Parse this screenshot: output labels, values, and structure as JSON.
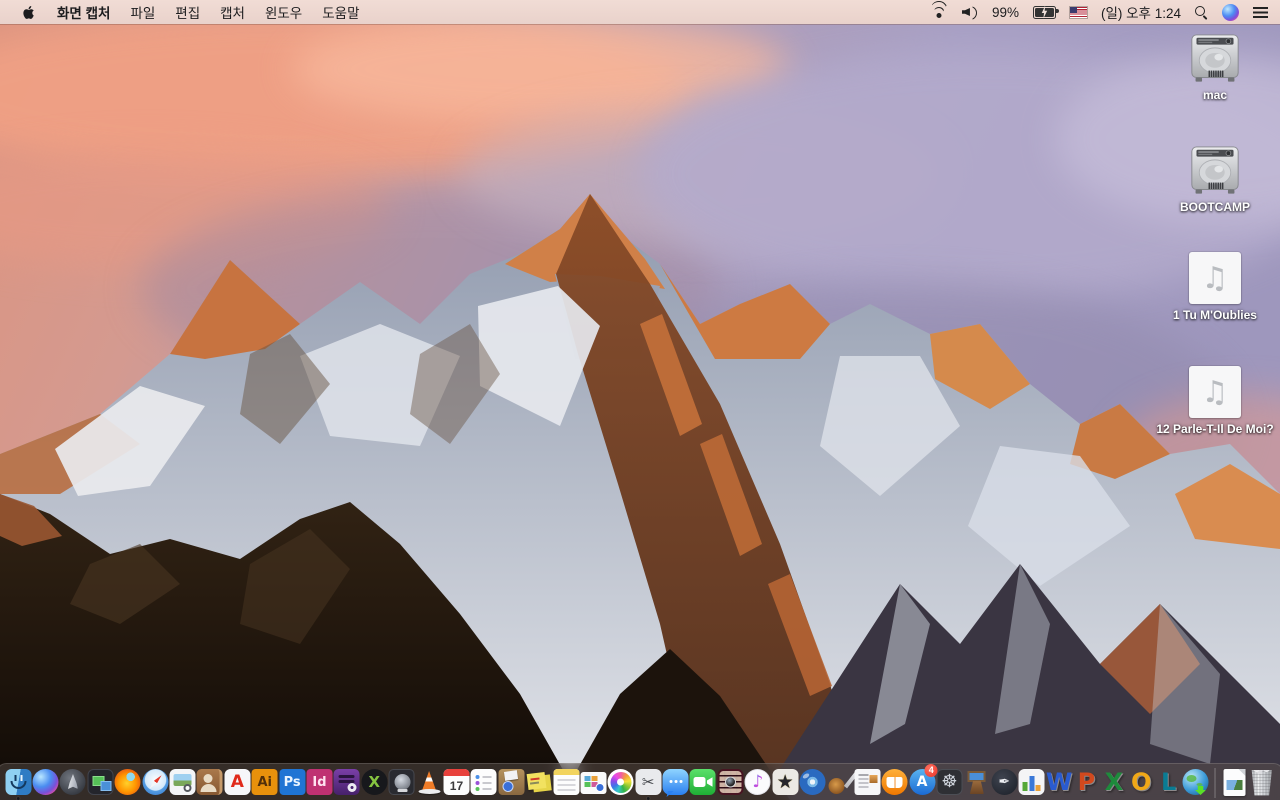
{
  "menu_bar": {
    "app_name": "화면 캡처",
    "menus": [
      "파일",
      "편집",
      "캡처",
      "윈도우",
      "도움말"
    ],
    "status": {
      "battery_percent": "99%",
      "clock": "(일) 오후 1:24"
    },
    "status_icons": [
      "wifi-icon",
      "volume-icon",
      "battery-charging-icon",
      "us-flag-icon",
      "spotlight-search-icon",
      "siri-icon",
      "notification-center-icon"
    ]
  },
  "desktop": {
    "icons": [
      {
        "id": "mac",
        "type": "drive",
        "label": "mac"
      },
      {
        "id": "bootcamp",
        "type": "drive",
        "label": "BOOTCAMP"
      },
      {
        "id": "song-1",
        "type": "audio",
        "label": "1 Tu M'Oublies"
      },
      {
        "id": "song-2",
        "type": "audio",
        "label": "12 Parle-T-Il De Moi?"
      }
    ]
  },
  "dock": {
    "items": [
      {
        "id": "finder",
        "name": "Finder",
        "running": true
      },
      {
        "id": "siri",
        "name": "Siri"
      },
      {
        "id": "launchpad",
        "name": "Launchpad"
      },
      {
        "id": "mission-control",
        "name": "Mission Control"
      },
      {
        "id": "firefox",
        "name": "Firefox"
      },
      {
        "id": "safari",
        "name": "Safari"
      },
      {
        "id": "preview",
        "name": "Preview"
      },
      {
        "id": "contacts",
        "name": "Contacts"
      },
      {
        "id": "acrobat",
        "name": "Adobe Acrobat Reader",
        "glyph": "A"
      },
      {
        "id": "illustrator",
        "name": "Adobe Illustrator",
        "glyph": "Ai"
      },
      {
        "id": "photoshop",
        "name": "Adobe Photoshop",
        "glyph": "Ps"
      },
      {
        "id": "indesign",
        "name": "Adobe InDesign",
        "glyph": "Id"
      },
      {
        "id": "toast",
        "name": "Toast Titanium"
      },
      {
        "id": "xee",
        "name": "Xee Image Viewer",
        "glyph": "X"
      },
      {
        "id": "drive-tool",
        "name": "Hard Drive Utility"
      },
      {
        "id": "vlc",
        "name": "VLC Media Player"
      },
      {
        "id": "calendar",
        "name": "Calendar",
        "day": "17"
      },
      {
        "id": "reminders",
        "name": "Reminders"
      },
      {
        "id": "archive-box",
        "name": "Archive Box Utility"
      },
      {
        "id": "stickies",
        "name": "Stickies"
      },
      {
        "id": "notes",
        "name": "Notes"
      },
      {
        "id": "image-doc",
        "name": "Image Document Utility"
      },
      {
        "id": "photos",
        "name": "Photos"
      },
      {
        "id": "grab",
        "name": "Grab Screen Capture",
        "glyph": "✂",
        "running": true
      },
      {
        "id": "messages",
        "name": "Messages"
      },
      {
        "id": "facetime",
        "name": "FaceTime"
      },
      {
        "id": "photo-booth",
        "name": "Photo Booth"
      },
      {
        "id": "itunes",
        "name": "iTunes",
        "glyph": "♪"
      },
      {
        "id": "imovie",
        "name": "iMovie",
        "glyph": "★"
      },
      {
        "id": "dvd-player",
        "name": "DVD Player"
      },
      {
        "id": "garageband",
        "name": "GarageBand"
      },
      {
        "id": "news-doc",
        "name": "Newspaper Document App"
      },
      {
        "id": "ibooks",
        "name": "iBooks"
      },
      {
        "id": "app-store",
        "name": "App Store",
        "glyph": "A",
        "badge": "4"
      },
      {
        "id": "wheel-app",
        "name": "Steering Wheel App",
        "glyph": "☸"
      },
      {
        "id": "keynote",
        "name": "Keynote"
      },
      {
        "id": "pages",
        "name": "Pages",
        "glyph": "✒"
      },
      {
        "id": "numbers",
        "name": "Numbers"
      },
      {
        "id": "word",
        "name": "Microsoft Word",
        "glyph": "W"
      },
      {
        "id": "powerpoint",
        "name": "Microsoft PowerPoint",
        "glyph": "P"
      },
      {
        "id": "excel",
        "name": "Microsoft Excel",
        "glyph": "X"
      },
      {
        "id": "outlook",
        "name": "Microsoft Outlook",
        "glyph": "O"
      },
      {
        "id": "lync",
        "name": "Microsoft Lync",
        "glyph": "L"
      },
      {
        "id": "msn-globe",
        "name": "Globe Download App"
      }
    ],
    "minimized": [
      {
        "id": "mini-doc",
        "name": "Minimized Image Document"
      }
    ],
    "trash": {
      "id": "trash",
      "name": "Trash",
      "state": "full"
    }
  },
  "colors": {
    "menu_bar_bg": "#eed7d0",
    "dock_bg": "rgba(92,81,78,0.48)",
    "sunlit_rock": "#c97a44",
    "sky_left": "#dc9480",
    "sky_right": "#9e97bd"
  }
}
